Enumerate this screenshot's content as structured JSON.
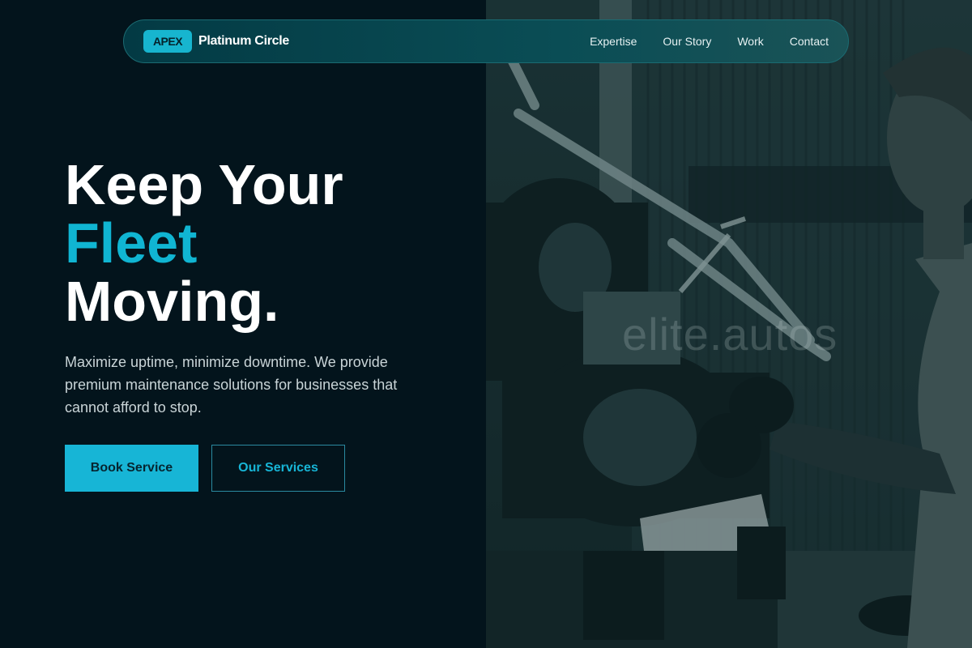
{
  "nav": {
    "badge": "APEX",
    "brand": "Platinum Circle",
    "links": [
      "Expertise",
      "Our Story",
      "Work",
      "Contact"
    ]
  },
  "hero": {
    "title_line1": "Keep Your",
    "title_accent": "Fleet",
    "title_line3": "Moving.",
    "subtitle": "Maximize uptime, minimize downtime. We provide premium maintenance solutions for businesses that cannot afford to stop.",
    "primary_cta": "Book Service",
    "secondary_cta": "Our Services"
  },
  "photo": {
    "watermark": "elite.autos",
    "subject": "mechanic-working-on-motorcycle-engine"
  },
  "colors": {
    "background": "#03141c",
    "accent": "#17b5d6",
    "nav_bg": "#0a4d55"
  }
}
